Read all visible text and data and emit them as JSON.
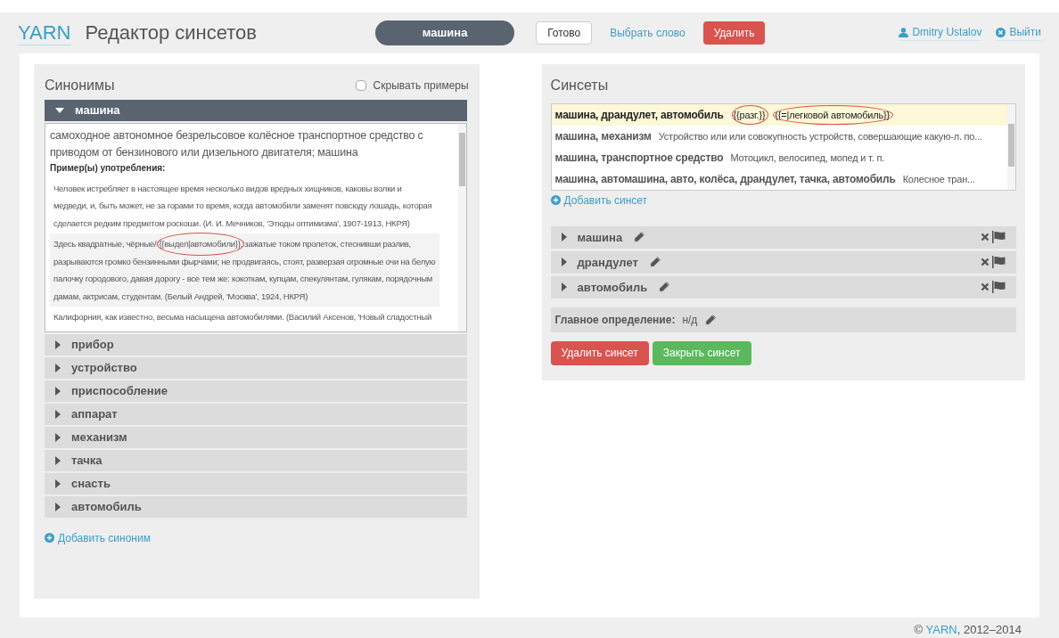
{
  "header": {
    "brand": "YARN",
    "title": "Редактор синсетов",
    "current_word": "машина",
    "buttons": [
      {
        "label": "Готово",
        "kind": "default"
      },
      {
        "label": "Выбрать слово",
        "kind": "link"
      },
      {
        "label": "Удалить",
        "kind": "danger"
      }
    ],
    "user": "Dmitry Ustalov",
    "logout": "Выйти"
  },
  "synonyms": {
    "title": "Синонимы",
    "hide_examples": {
      "label": "Скрывать примеры",
      "checked": false
    },
    "items": [
      {
        "word": "машина",
        "expanded": true,
        "definition": "самоходное автономное безрельсовое колёсное транспортное средство с приводом от бензинового или дизельного двигателя; машина",
        "examples_heading": "Пример(ы) употребления:",
        "examples": [
          {
            "highlighted": false,
            "parts": [
              {
                "text": "Человек истребляет в настоящее время несколько видов вредных хищников, каковы волки и медведи, и, быть может, не за горами то время, когда автомобили заменят повсюду лошадь, которая сделается редким предметом роскоши. (И. И. Мечников, 'Этюды оптимизма', 1907-1913, НКРЯ)",
                "circled": false
              }
            ]
          },
          {
            "highlighted": true,
            "parts": [
              {
                "text": "Здесь квадратные, чёрные/",
                "circled": false
              },
              {
                "text": "{{выдел|автомобили}}",
                "circled": true
              },
              {
                "text": ", зажатые током пролеток, стеснивши разлив, разрываются громко бензинными фырчами; не продвигаясь, стоят, разверзая огромные очи на белую палочку городового, давая дорогу - все тем же: кокоткам, купцам, спекулянтам, гулякам, порядочным дамам, актрисам, студентам. (Белый Андрей, 'Москва', 1924, НКРЯ)",
                "circled": false
              }
            ]
          },
          {
            "highlighted": false,
            "parts": [
              {
                "text": "Калифорния, как известно, весьма насыщена автомобилями. (Василий Аксенов, 'Новый сладостный",
                "circled": false
              }
            ]
          }
        ]
      },
      {
        "word": "прибор",
        "expanded": false
      },
      {
        "word": "устройство",
        "expanded": false
      },
      {
        "word": "приспособление",
        "expanded": false
      },
      {
        "word": "аппарат",
        "expanded": false
      },
      {
        "word": "механизм",
        "expanded": false
      },
      {
        "word": "тачка",
        "expanded": false
      },
      {
        "word": "снасть",
        "expanded": false
      },
      {
        "word": "автомобиль",
        "expanded": false
      }
    ],
    "add_label": "Добавить синоним"
  },
  "synsets": {
    "title": "Синсеты",
    "rows": [
      {
        "words": "машина, драндулет, автомобиль",
        "selected": true,
        "gloss": [
          {
            "text": "{{разг.}}",
            "circled": true
          },
          {
            "text": "{{=|легковой автомобиль}}",
            "circled": true
          }
        ]
      },
      {
        "words": "машина, механизм",
        "selected": false,
        "gloss": [
          {
            "text": "Устройство или или совокупность устройств, совершающие какую-л. по...",
            "circled": false
          }
        ]
      },
      {
        "words": "машина, транспортное средство",
        "selected": false,
        "gloss": [
          {
            "text": "Мотоцикл, велосипед, мопед и т. п.",
            "circled": false
          }
        ]
      },
      {
        "words": "машина, автомашина, авто, колёса, драндулет, тачка, автомобиль",
        "selected": false,
        "gloss": [
          {
            "text": "Колесное тран...",
            "circled": false
          }
        ]
      }
    ],
    "add_label": "Добавить синсет",
    "words": [
      {
        "word": "машина"
      },
      {
        "word": "драндулет"
      },
      {
        "word": "автомобиль"
      }
    ],
    "main_definition": {
      "label": "Главное определение:",
      "value": "н/д"
    },
    "buttons": [
      {
        "label": "Удалить синсет",
        "kind": "danger"
      },
      {
        "label": "Закрыть синсет",
        "kind": "success"
      }
    ]
  },
  "footer": {
    "prefix": "© ",
    "link": "YARN",
    "suffix": ", 2012–2014"
  }
}
